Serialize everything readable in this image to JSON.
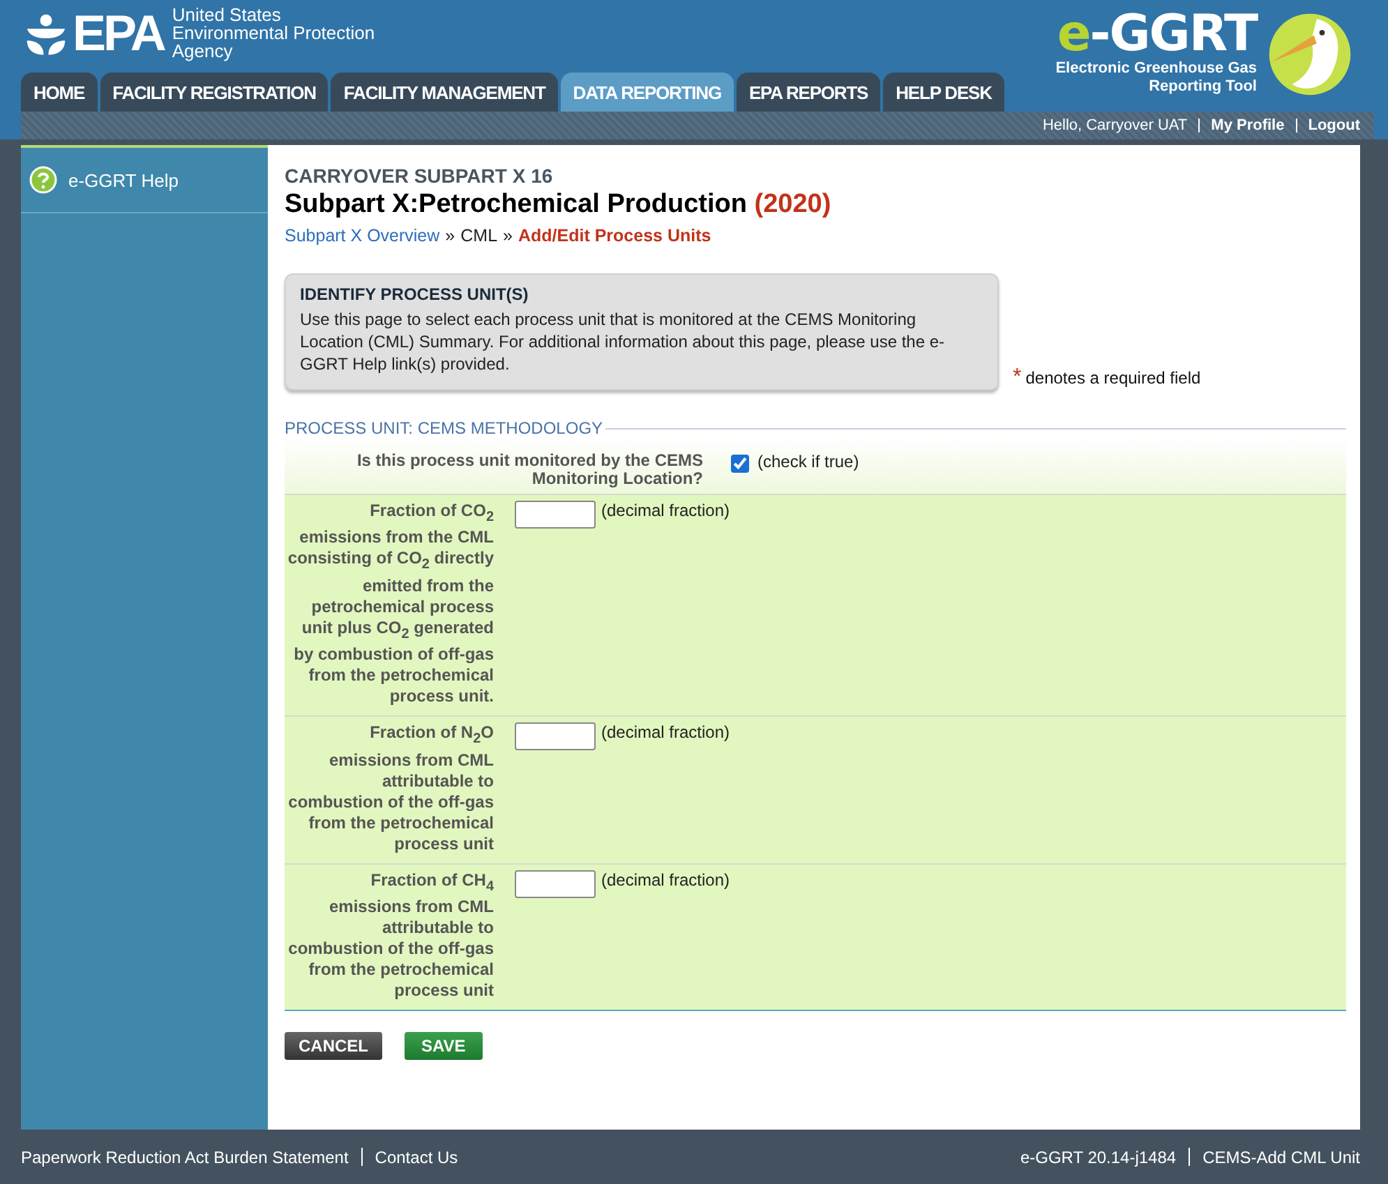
{
  "header": {
    "agency_logo": "EPA",
    "agency_lines": [
      "United States",
      "Environmental Protection",
      "Agency"
    ],
    "tool_logo": {
      "prefix": "e",
      "rest": "-GGRT"
    },
    "tool_name_lines": [
      "Electronic Greenhouse Gas",
      "Reporting Tool"
    ]
  },
  "tabs": [
    {
      "label": "HOME",
      "selected": false
    },
    {
      "label": "FACILITY REGISTRATION",
      "selected": false
    },
    {
      "label": "FACILITY MANAGEMENT",
      "selected": false
    },
    {
      "label": "DATA REPORTING",
      "selected": true
    },
    {
      "label": "EPA REPORTS",
      "selected": false
    },
    {
      "label": "HELP DESK",
      "selected": false
    }
  ],
  "user_bar": [
    {
      "text": "Hello, Carryover UAT",
      "kind": "plain"
    },
    {
      "text": "My Profile",
      "kind": "link"
    },
    {
      "text": "Logout",
      "kind": "link"
    }
  ],
  "sidebar": {
    "items": [
      {
        "label": "e-GGRT Help"
      }
    ]
  },
  "content": {
    "overline": "CARRYOVER SUBPART X 16",
    "title": "Subpart X:Petrochemical Production",
    "year": "(2020)",
    "breadcrumbs": [
      {
        "text": "Subpart X Overview",
        "kind": "link"
      },
      {
        "text": "CML",
        "kind": "plain"
      },
      {
        "text": "Add/Edit Process Units",
        "kind": "current"
      }
    ],
    "breadcrumb_separator": "»",
    "info_box": {
      "title": "IDENTIFY PROCESS UNIT(S)",
      "text": "Use this page to select each process unit that is monitored at the CEMS Monitoring Location (CML) Summary. For additional information about this page, please use the e-GGRT Help link(s) provided."
    },
    "required_note": {
      "mark": "*",
      "text": "denotes a required field"
    },
    "section_title": "PROCESS UNIT: CEMS METHODOLOGY",
    "fields": [
      {
        "kind": "checkbox",
        "label": "Is this process unit monitored by the CEMS Monitoring Location?",
        "checked": true,
        "hint": "(check if true)"
      },
      {
        "kind": "text",
        "label": "Fraction of CO$_{2}$ emissions from the CML consisting of CO$_{2}$ directly emitted from the petrochemical process unit plus CO$_{2}$ generated by combustion of off-gas from the petrochemical process unit.",
        "hint": "(decimal fraction)"
      },
      {
        "kind": "text",
        "label": "Fraction of N$_{2}$O emissions from CML attributable to combustion of the off-gas from the petrochemical process unit",
        "hint": "(decimal fraction)"
      },
      {
        "kind": "text",
        "label": "Fraction of CH$_{4}$ emissions from CML attributable to combustion of the off-gas from the petrochemical process unit",
        "hint": "(decimal fraction)"
      }
    ],
    "buttons": [
      {
        "label": "CANCEL",
        "kind": "cancel"
      },
      {
        "label": "SAVE",
        "kind": "save"
      }
    ]
  },
  "footer": {
    "left": [
      "Paperwork Reduction Act Burden Statement",
      "Contact Us"
    ],
    "right": [
      "e-GGRT 20.14-j1484",
      "CEMS-Add CML Unit"
    ]
  }
}
